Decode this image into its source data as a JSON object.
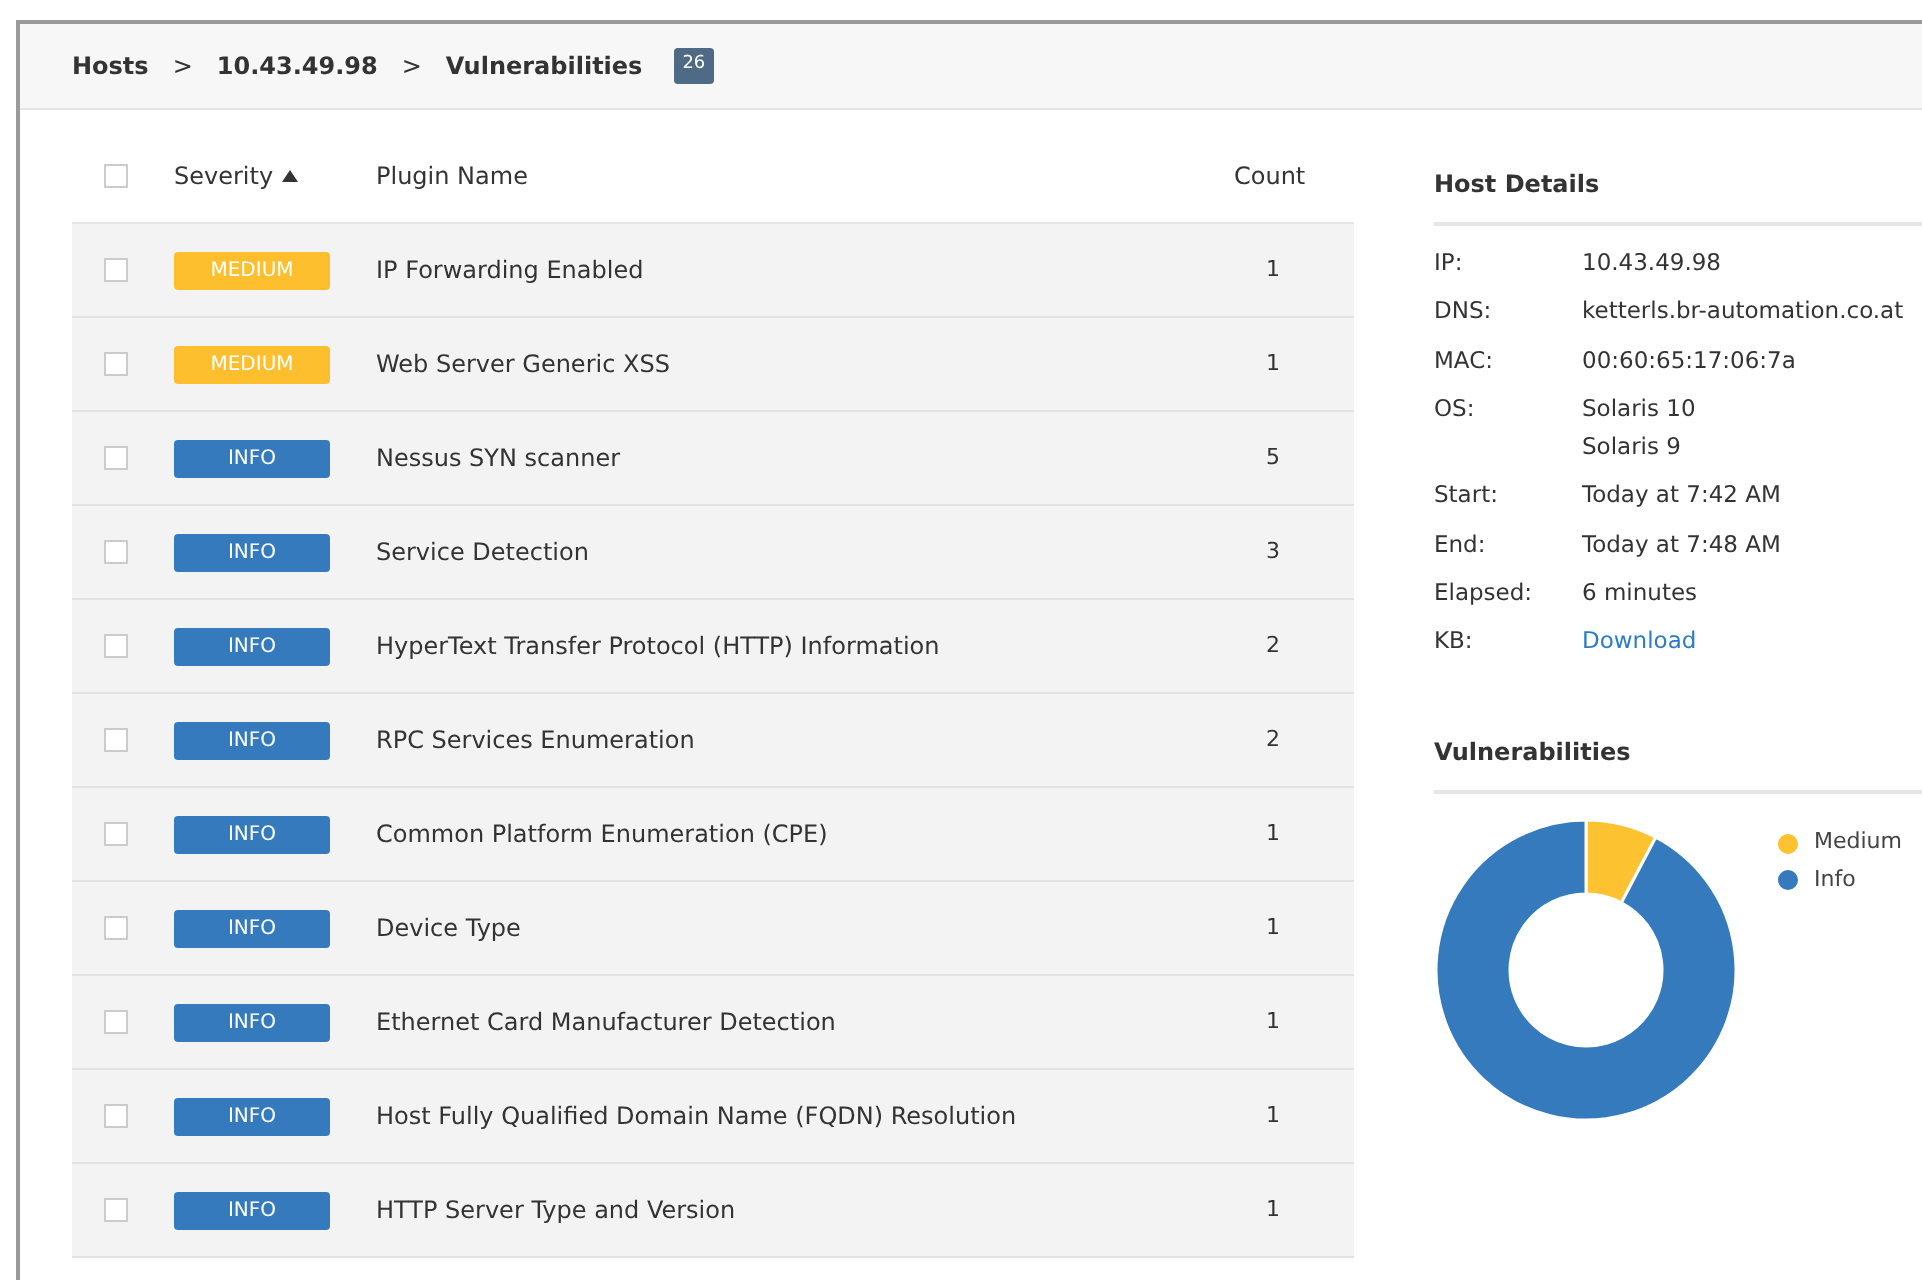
{
  "breadcrumb": [
    {
      "label": "Hosts"
    },
    {
      "label": "10.43.49.98"
    },
    {
      "label": "Vulnerabilities"
    }
  ],
  "breadcrumb_separator": ">",
  "count_badge": "26",
  "table": {
    "columns": [
      {
        "label": "Severity",
        "sorted": true
      },
      {
        "label": "Plugin Name",
        "sorted": false
      },
      {
        "label": "Count",
        "sorted": false
      }
    ],
    "select_all": false,
    "rows": [
      {
        "severity": "MEDIUM",
        "kind": "medium",
        "name": "IP Forwarding Enabled",
        "count": "1",
        "checked": false
      },
      {
        "severity": "MEDIUM",
        "kind": "medium",
        "name": "Web Server Generic XSS",
        "count": "1",
        "checked": false
      },
      {
        "severity": "INFO",
        "kind": "info",
        "name": "Nessus SYN scanner",
        "count": "5",
        "checked": false
      },
      {
        "severity": "INFO",
        "kind": "info",
        "name": "Service Detection",
        "count": "3",
        "checked": false
      },
      {
        "severity": "INFO",
        "kind": "info",
        "name": "HyperText Transfer Protocol (HTTP) Information",
        "count": "2",
        "checked": false
      },
      {
        "severity": "INFO",
        "kind": "info",
        "name": "RPC Services Enumeration",
        "count": "2",
        "checked": false
      },
      {
        "severity": "INFO",
        "kind": "info",
        "name": "Common Platform Enumeration (CPE)",
        "count": "1",
        "checked": false
      },
      {
        "severity": "INFO",
        "kind": "info",
        "name": "Device Type",
        "count": "1",
        "checked": false
      },
      {
        "severity": "INFO",
        "kind": "info",
        "name": "Ethernet Card Manufacturer Detection",
        "count": "1",
        "checked": false
      },
      {
        "severity": "INFO",
        "kind": "info",
        "name": "Host Fully Qualified Domain Name (FQDN) Resolution",
        "count": "1",
        "checked": false
      },
      {
        "severity": "INFO",
        "kind": "info",
        "name": "HTTP Server Type and Version",
        "count": "1",
        "checked": false
      }
    ]
  },
  "host_details": {
    "title": "Host Details",
    "fields": [
      {
        "label": "IP:",
        "values": [
          "10.43.49.98"
        ]
      },
      {
        "label": "DNS:",
        "values": [
          "ketterls.br-automation.co.at"
        ]
      },
      {
        "label": "MAC:",
        "values": [
          "00:60:65:17:06:7a"
        ]
      },
      {
        "label": "OS:",
        "values": [
          "Solaris 10",
          "Solaris 9"
        ]
      },
      {
        "label": "Start:",
        "values": [
          "Today at 7:42 AM"
        ]
      },
      {
        "label": "End:",
        "values": [
          "Today at 7:48 AM"
        ]
      },
      {
        "label": "Elapsed:",
        "values": [
          "6 minutes"
        ]
      },
      {
        "label": "KB:",
        "values": [
          "Download"
        ],
        "kind": "link"
      }
    ]
  },
  "vulnerabilities": {
    "title": "Vulnerabilities",
    "chart_data": {
      "type": "donut",
      "categories": [
        "Medium",
        "Info"
      ],
      "series": [
        {
          "values": [
            7.7,
            92.3
          ]
        }
      ],
      "colors": [
        "#fcc22f",
        "#357abd"
      ],
      "legend": "right"
    }
  }
}
